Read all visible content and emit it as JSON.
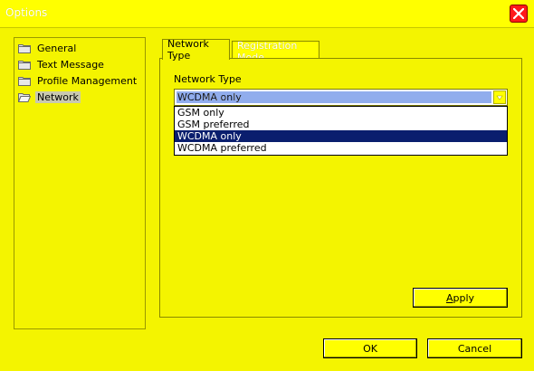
{
  "window": {
    "title": "Options"
  },
  "sidebar": {
    "items": [
      {
        "label": "General",
        "icon": "folder-closed-icon",
        "selected": false
      },
      {
        "label": "Text Message",
        "icon": "folder-closed-icon",
        "selected": false
      },
      {
        "label": "Profile Management",
        "icon": "folder-closed-icon",
        "selected": false
      },
      {
        "label": "Network",
        "icon": "folder-open-icon",
        "selected": true
      }
    ]
  },
  "tabs": [
    {
      "label": "Network Type",
      "active": true
    },
    {
      "label": "Registration Mode",
      "active": false
    }
  ],
  "network_type": {
    "label": "Network Type",
    "selected_value": "WCDMA only",
    "options": [
      "GSM only",
      "GSM preferred",
      "WCDMA only",
      "WCDMA preferred"
    ],
    "highlighted_index": 2
  },
  "buttons": {
    "apply_first": "A",
    "apply_rest": "pply",
    "ok": "OK",
    "cancel": "Cancel"
  },
  "colors": {
    "background": "#f4f400",
    "close_button": "#ff1a1a",
    "selection": "#0a1e6e"
  }
}
